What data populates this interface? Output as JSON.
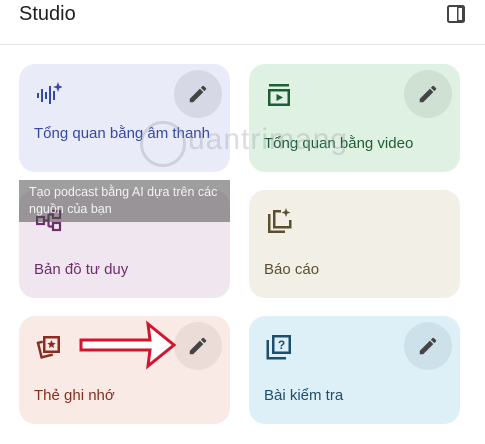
{
  "header": {
    "title": "Studio",
    "panel_icon": "side-panel-icon"
  },
  "cards": {
    "audio": {
      "label": "Tổng quan bằng âm thanh",
      "icon": "audio-waveform-icon",
      "color": "#3449a3",
      "bg": "#e9ebf9"
    },
    "video": {
      "label": "Tổng quan bằng video",
      "icon": "video-play-icon",
      "color": "#1e5e33",
      "bg": "#dff1e3"
    },
    "mind_map": {
      "label": "Bản đồ tư duy",
      "icon": "mind-map-icon",
      "color": "#6e2e6b",
      "bg": "#f0e6ef",
      "tooltip": "Tạo podcast bằng AI dựa trên các nguồn của bạn"
    },
    "report": {
      "label": "Báo cáo",
      "icon": "report-sparkle-icon",
      "color": "#5a4f2e",
      "bg": "#f1efe6"
    },
    "flashcards": {
      "label": "Thẻ ghi nhớ",
      "icon": "flashcard-star-icon",
      "color": "#8a2c1f",
      "bg": "#faeae6"
    },
    "quiz": {
      "label": "Bài kiểm tra",
      "icon": "quiz-question-icon",
      "color": "#1d4e6b",
      "bg": "#def0f7"
    }
  },
  "edit_icon": "pencil-icon",
  "watermark": {
    "text": "uantrimang"
  }
}
